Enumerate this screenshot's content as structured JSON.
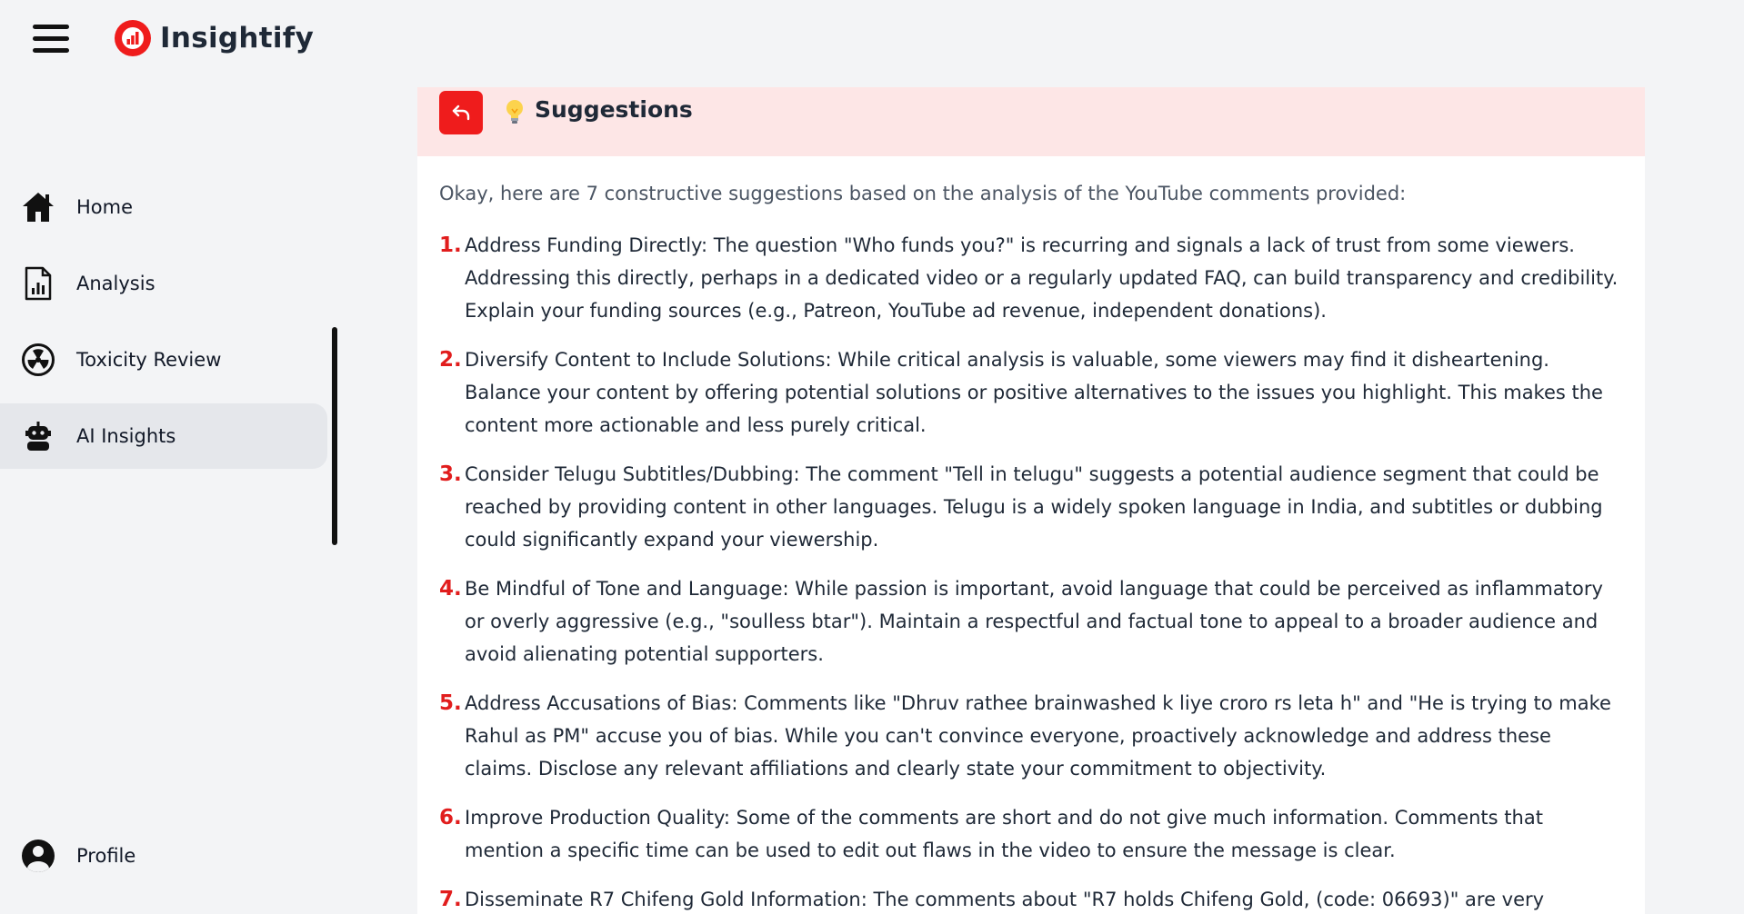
{
  "app": {
    "name": "Insightify"
  },
  "icons": {
    "menu": "hamburger-icon",
    "logo": "insightify-logo-icon",
    "home": "home-icon",
    "analysis": "analysis-report-icon",
    "toxicity": "radiation-icon",
    "ai": "robot-icon",
    "profile": "user-circle-icon",
    "back": "return-arrow-icon",
    "bulb": "lightbulb-icon"
  },
  "colors": {
    "brand_red": "#ef1c1c",
    "header_bg": "#fde6e6",
    "active_nav_bg": "#e5e7eb",
    "number_red": "#e11d1d"
  },
  "sidebar": {
    "items": [
      {
        "label": "Home"
      },
      {
        "label": "Analysis"
      },
      {
        "label": "Toxicity Review"
      },
      {
        "label": "AI Insights",
        "active": true
      }
    ],
    "profile": {
      "label": "Profile"
    }
  },
  "panel": {
    "title": "Suggestions",
    "intro": "Okay, here are 7 constructive suggestions based on the analysis of the YouTube comments provided:",
    "suggestions": [
      {
        "num": "1.",
        "text": "Address Funding Directly: The question \"Who funds you?\" is recurring and signals a lack of trust from some viewers. Addressing this directly, perhaps in a dedicated video or a regularly updated FAQ, can build transparency and credibility. Explain your funding sources (e.g., Patreon, YouTube ad revenue, independent donations)."
      },
      {
        "num": "2.",
        "text": "Diversify Content to Include Solutions: While critical analysis is valuable, some viewers may find it disheartening. Balance your content by offering potential solutions or positive alternatives to the issues you highlight. This makes the content more actionable and less purely critical."
      },
      {
        "num": "3.",
        "text": "Consider Telugu Subtitles/Dubbing: The comment \"Tell in telugu\" suggests a potential audience segment that could be reached by providing content in other languages. Telugu is a widely spoken language in India, and subtitles or dubbing could significantly expand your viewership."
      },
      {
        "num": "4.",
        "text": "Be Mindful of Tone and Language: While passion is important, avoid language that could be perceived as inflammatory or overly aggressive (e.g., \"soulless btar\"). Maintain a respectful and factual tone to appeal to a broader audience and avoid alienating potential supporters."
      },
      {
        "num": "5.",
        "text": "Address Accusations of Bias: Comments like \"Dhruv rathee brainwashed k liye croro rs leta h\" and \"He is trying to make Rahul as PM\" accuse you of bias. While you can't convince everyone, proactively acknowledge and address these claims. Disclose any relevant affiliations and clearly state your commitment to objectivity."
      },
      {
        "num": "6.",
        "text": "Improve Production Quality: Some of the comments are short and do not give much information. Comments that mention a specific time can be used to edit out flaws in the video to ensure the message is clear."
      },
      {
        "num": "7.",
        "text": "Disseminate R7 Chifeng Gold Information: The comments about \"R7 holds Chifeng Gold, (code: 06693)\" are very"
      }
    ]
  }
}
